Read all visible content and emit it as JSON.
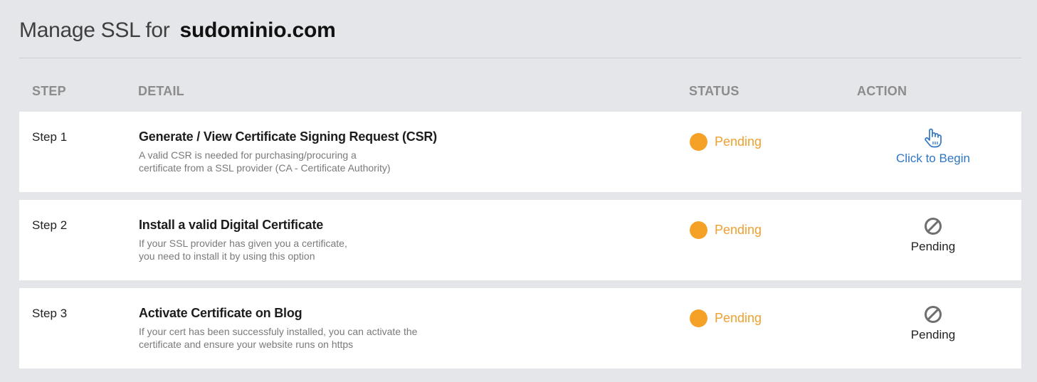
{
  "header": {
    "title_prefix": "Manage SSL for",
    "domain": "sudominio.com"
  },
  "table": {
    "columns": {
      "step": "STEP",
      "detail": "DETAIL",
      "status": "STATUS",
      "action": "ACTION"
    },
    "rows": [
      {
        "step": "Step 1",
        "title": "Generate / View Certificate Signing Request (CSR)",
        "description_line1": "A valid CSR is needed for purchasing/procuring a",
        "description_line2": "certificate from a SSL provider (CA - Certificate Authority)",
        "status": "Pending",
        "status_color": "#f5a128",
        "action_label": "Click to Begin",
        "action_icon": "hand-pointer-icon",
        "action_enabled": true
      },
      {
        "step": "Step 2",
        "title": "Install a valid Digital Certificate",
        "description_line1": "If your SSL provider has given you a certificate,",
        "description_line2": "you need to install it by using this option",
        "status": "Pending",
        "status_color": "#f5a128",
        "action_label": "Pending",
        "action_icon": "prohibited-icon",
        "action_enabled": false
      },
      {
        "step": "Step 3",
        "title": "Activate Certificate on Blog",
        "description_line1": "If your cert has been successfuly installed, you can activate the",
        "description_line2": "certificate and ensure your website runs on https",
        "status": "Pending",
        "status_color": "#f5a128",
        "action_label": "Pending",
        "action_icon": "prohibited-icon",
        "action_enabled": false
      }
    ]
  },
  "colors": {
    "background": "#e5e6ea",
    "link": "#2f76c3",
    "pending": "#f5a128",
    "header_text": "#8c8c8c"
  }
}
